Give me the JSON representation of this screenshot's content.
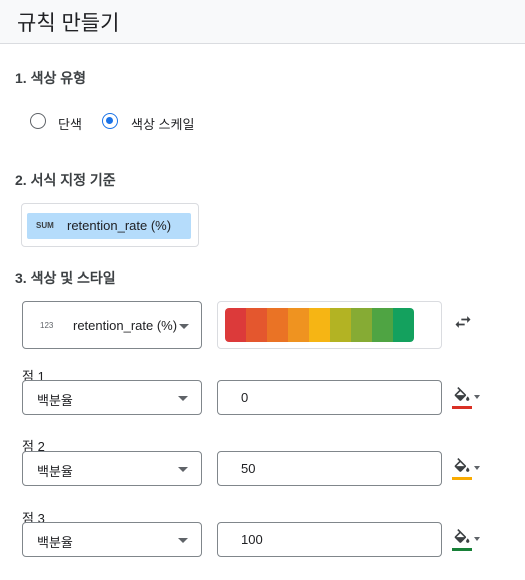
{
  "header": {
    "title": "규칙 만들기"
  },
  "sections": {
    "color_type": {
      "title": "1. 색상 유형"
    },
    "format_basis": {
      "title": "2. 서식 지정 기준"
    },
    "color_style": {
      "title": "3. 색상 및 스타일"
    }
  },
  "color_type": {
    "options": [
      {
        "label": "단색",
        "checked": false
      },
      {
        "label": "색상 스케일",
        "checked": true
      }
    ]
  },
  "format_basis": {
    "aggregation": "SUM",
    "field": "retention_rate (%)"
  },
  "color_style": {
    "field_select": {
      "type_icon": "123",
      "value": "retention_rate (%)"
    },
    "scale_colors": [
      "#dc3a3a",
      "#e4572e",
      "#ea7325",
      "#ef9320",
      "#f6b514",
      "#b3b323",
      "#86ab34",
      "#4fa443",
      "#14a15e"
    ],
    "swap_icon": "swap-horiz-icon"
  },
  "points": [
    {
      "label": "점 1",
      "type": "백분율",
      "value": "0",
      "color": "#d93025"
    },
    {
      "label": "점 2",
      "type": "백분율",
      "value": "50",
      "color": "#f9ab00"
    },
    {
      "label": "점 3",
      "type": "백분율",
      "value": "100",
      "color": "#188038"
    }
  ],
  "icons": {
    "fill": "format-color-fill-icon",
    "dropdown": "arrow-drop-down-icon"
  }
}
